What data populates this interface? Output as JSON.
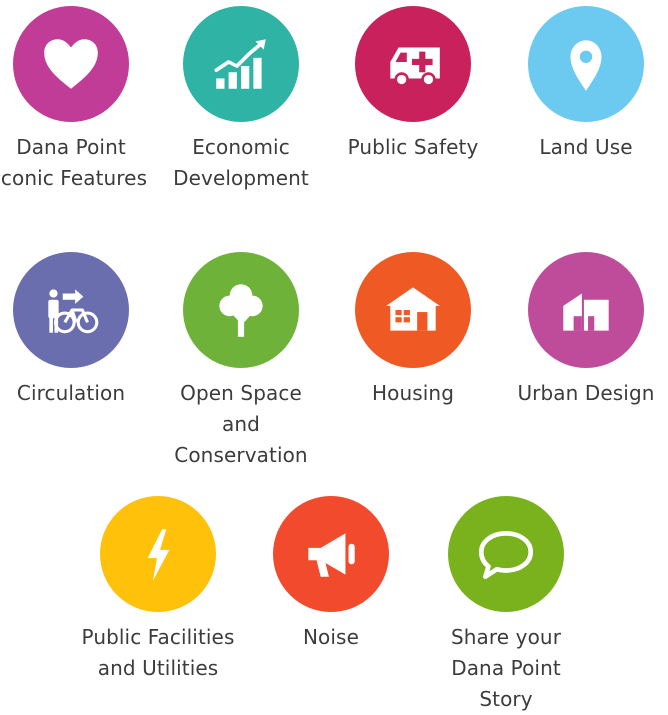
{
  "topics": [
    {
      "label": "Dana Point Iconic Features",
      "color": "#c13c97",
      "icon": "heart-icon"
    },
    {
      "label": "Economic Development",
      "color": "#2fb3a5",
      "icon": "bar-chart-icon"
    },
    {
      "label": "Public Safety",
      "color": "#c8215b",
      "icon": "ambulance-icon"
    },
    {
      "label": "Land Use",
      "color": "#6cc9f0",
      "icon": "map-pin-icon"
    },
    {
      "label": "Circulation",
      "color": "#6b6eae",
      "icon": "pedestrian-bicycle-icon"
    },
    {
      "label": "Open Space and Conservation",
      "color": "#6fb23a",
      "icon": "tree-icon"
    },
    {
      "label": "Housing",
      "color": "#ef5a24",
      "icon": "house-icon"
    },
    {
      "label": "Urban Design",
      "color": "#bf4c9b",
      "icon": "building-icon"
    },
    {
      "label": "Public Facilities and Utilities",
      "color": "#ffc10a",
      "icon": "lightning-bolt-icon"
    },
    {
      "label": "Noise",
      "color": "#f24a2c",
      "icon": "megaphone-icon"
    },
    {
      "label": "Share your Dana Point Story",
      "color": "#7ab21e",
      "icon": "speech-bubble-icon"
    }
  ]
}
